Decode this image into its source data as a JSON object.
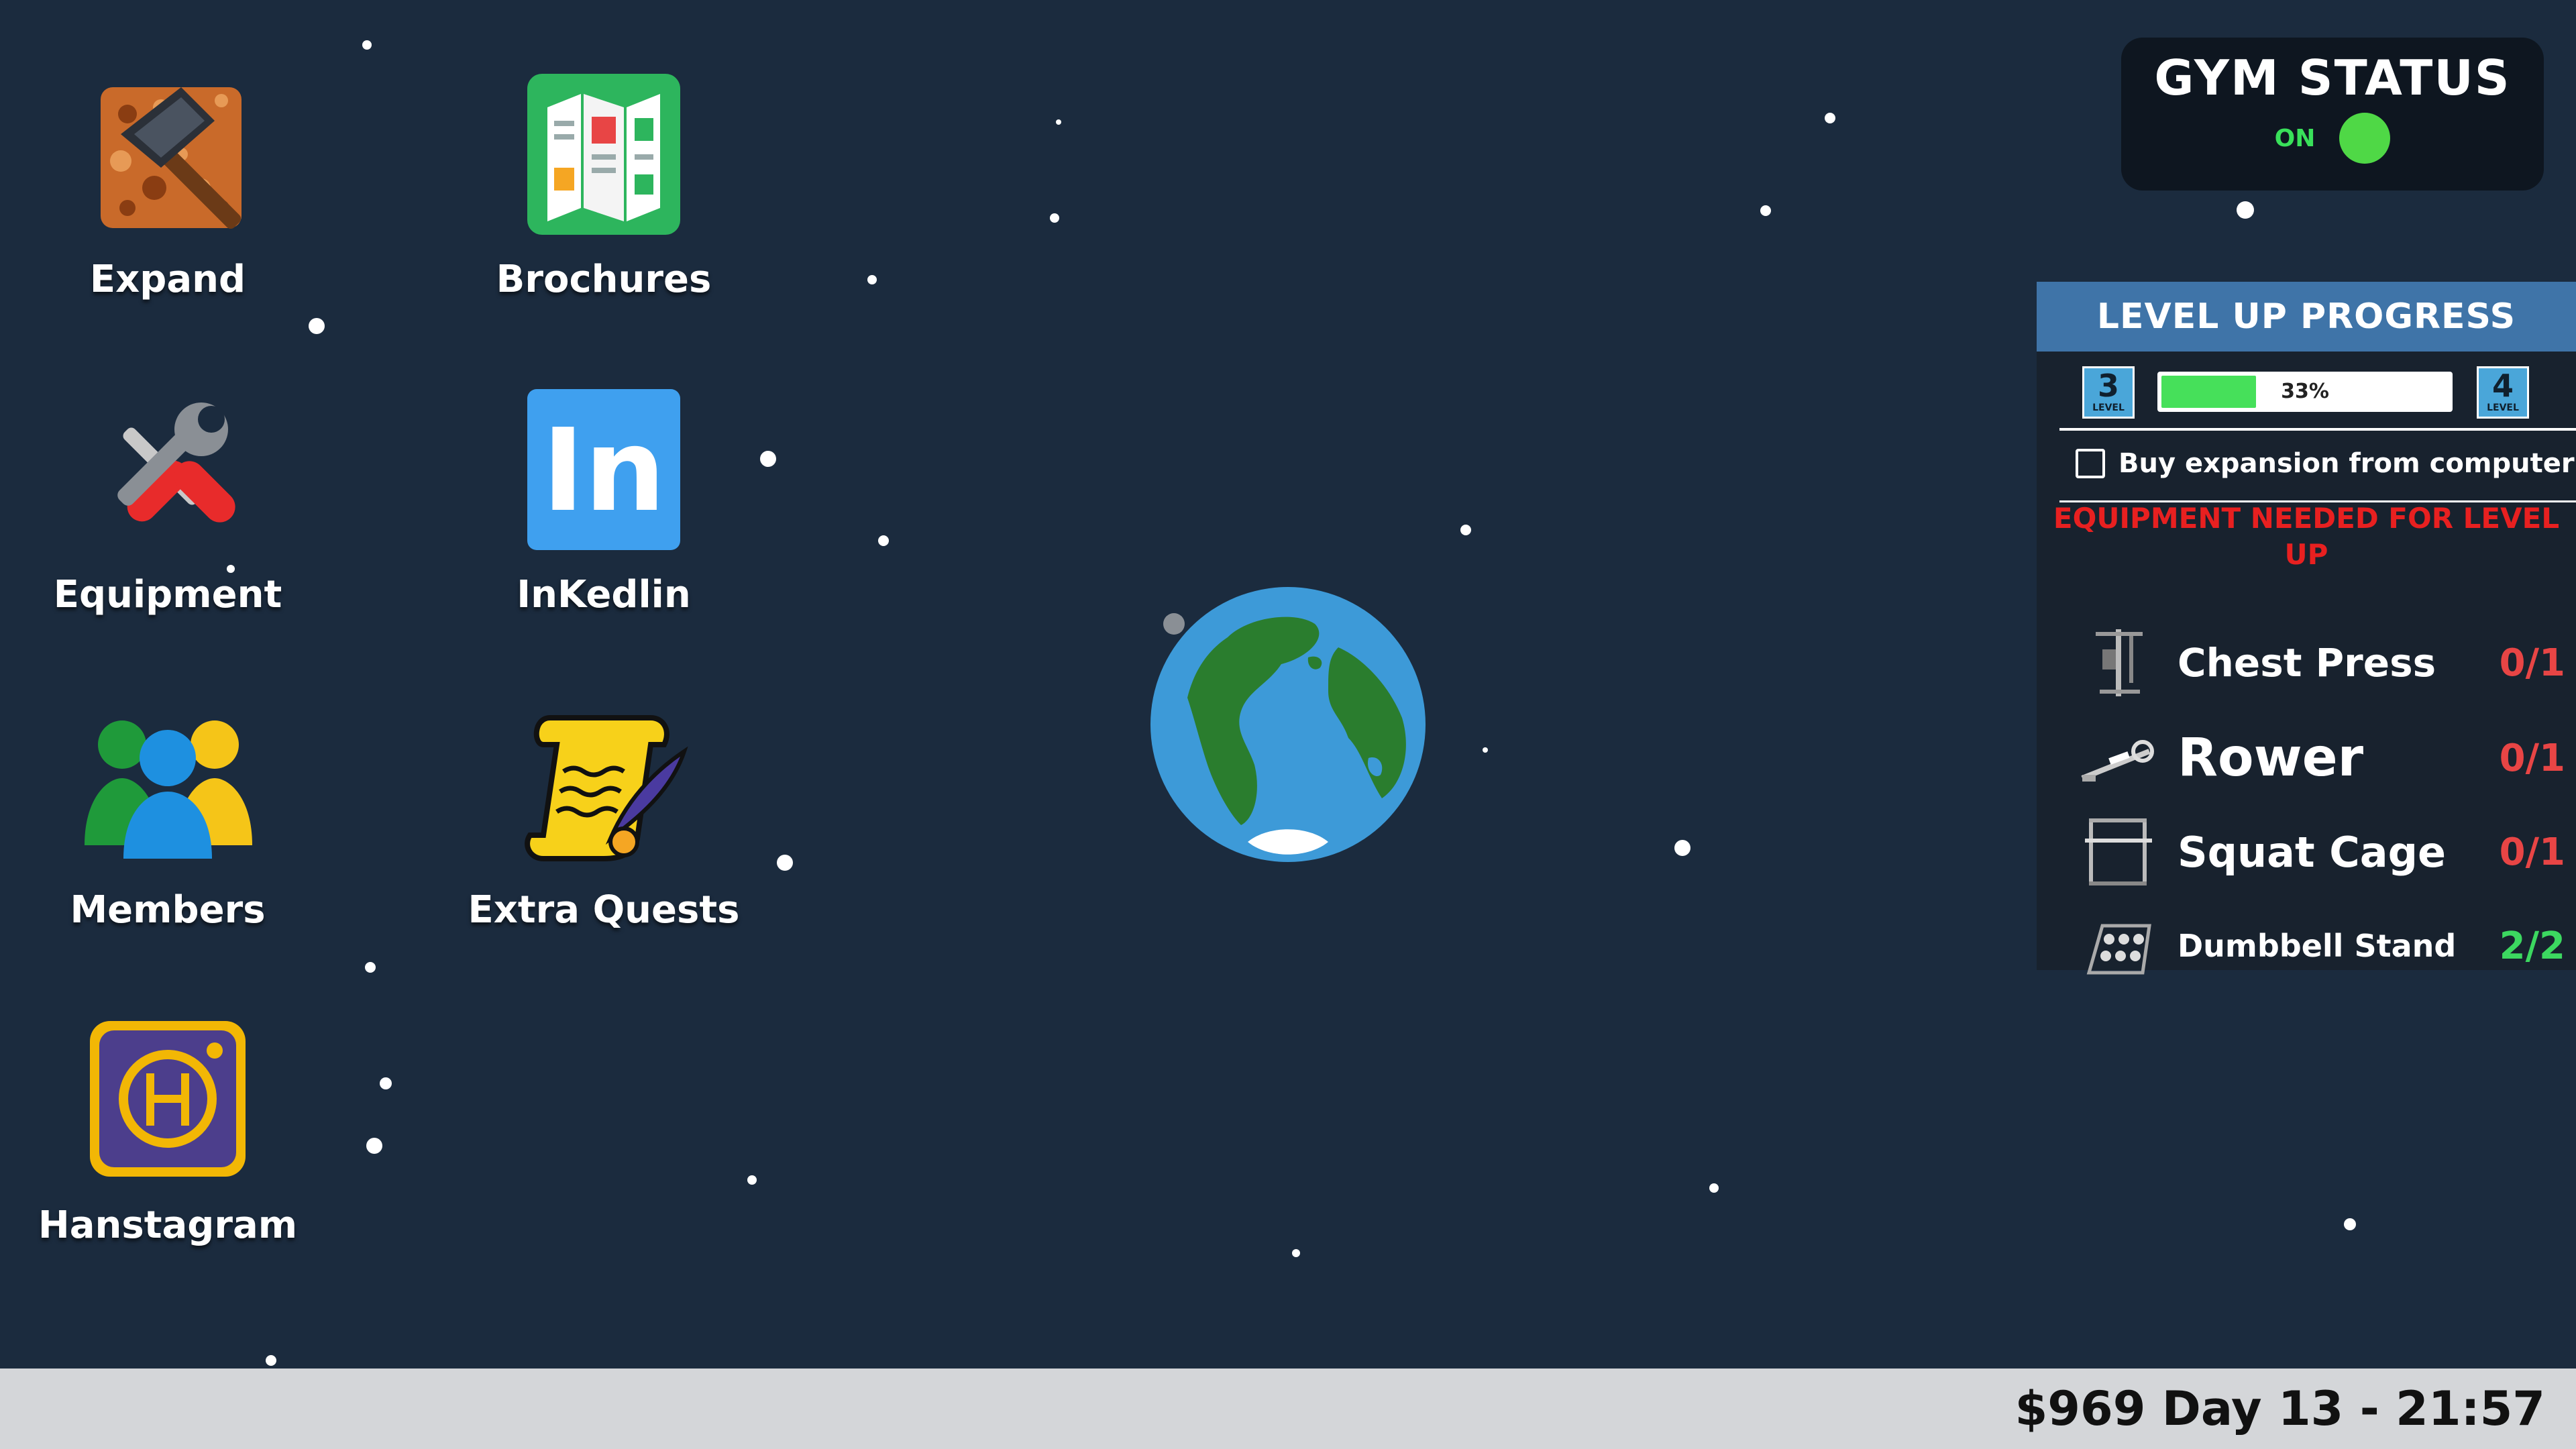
{
  "apps": [
    {
      "label": "Expand",
      "icon": "pickaxe-icon"
    },
    {
      "label": "Brochures",
      "icon": "brochure-icon"
    },
    {
      "label": "Equipment",
      "icon": "tools-icon"
    },
    {
      "label": "InKedlin",
      "icon": "inkedlin-icon"
    },
    {
      "label": "Members",
      "icon": "people-icon"
    },
    {
      "label": "Extra Quests",
      "icon": "scroll-quill-icon"
    },
    {
      "label": "Hanstagram",
      "icon": "camera-icon"
    }
  ],
  "gym_status": {
    "title": "GYM STATUS",
    "state": "ON",
    "indicator_color": "#4fd846"
  },
  "level_progress": {
    "title": "LEVEL UP PROGRESS",
    "current_level": "3",
    "next_level": "4",
    "level_caption": "LEVEL",
    "progress": 0.33,
    "progress_label": "33%",
    "expansion_label": "Buy expansion from computer",
    "expansion_checked": false,
    "equipment_needed_label": "EQUIPMENT NEEDED FOR LEVEL UP",
    "equipment": [
      {
        "name": "Chest Press",
        "count": "0/1",
        "status": "incomplete",
        "icon": "chest-press-icon"
      },
      {
        "name": "Rower",
        "count": "0/1",
        "status": "incomplete",
        "icon": "rower-icon"
      },
      {
        "name": "Squat Cage",
        "count": "0/1",
        "status": "incomplete",
        "icon": "squat-cage-icon"
      },
      {
        "name": "Dumbbell Stand",
        "count": "2/2",
        "status": "complete",
        "icon": "dumbbell-stand-icon"
      }
    ]
  },
  "taskbar": {
    "status_text": "$969 Day 13 - 21:57"
  },
  "colors": {
    "background": "#1b2b3e",
    "incomplete": "#e84545",
    "complete": "#3cd860",
    "header": "#3f74a8"
  }
}
